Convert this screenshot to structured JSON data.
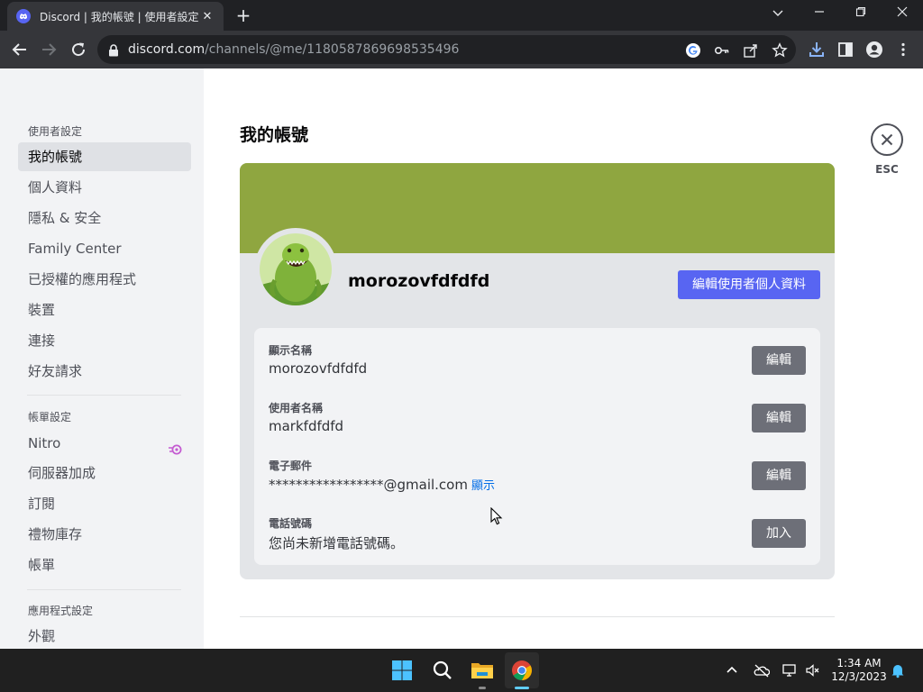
{
  "browser": {
    "tab_title": "Discord | 我的帳號 | 使用者設定",
    "url_host": "discord.com",
    "url_path": "/channels/@me/1180587869698535496"
  },
  "sidebar": {
    "user_settings_header": "使用者設定",
    "user_items": [
      {
        "label": "我的帳號",
        "active": true
      },
      {
        "label": "個人資料"
      },
      {
        "label": "隱私 & 安全"
      },
      {
        "label": "Family Center"
      },
      {
        "label": "已授權的應用程式"
      },
      {
        "label": "裝置"
      },
      {
        "label": "連接"
      },
      {
        "label": "好友請求"
      }
    ],
    "billing_settings_header": "帳單設定",
    "billing_items": [
      {
        "label": "Nitro"
      },
      {
        "label": "伺服器加成"
      },
      {
        "label": "訂閱"
      },
      {
        "label": "禮物庫存"
      },
      {
        "label": "帳單"
      }
    ],
    "app_settings_header": "應用程式設定",
    "app_items": [
      {
        "label": "外觀"
      }
    ]
  },
  "main": {
    "title": "我的帳號",
    "close_label": "ESC",
    "banner_color": "#8fa640",
    "username": "morozovfdfdfd",
    "edit_profile_label": "編輯使用者個人資料",
    "fields": [
      {
        "label": "顯示名稱",
        "value": "morozovfdfdfd",
        "button": "編輯"
      },
      {
        "label": "使用者名稱",
        "value": "markfdfdfd",
        "button": "編輯"
      },
      {
        "label": "電子郵件",
        "value": "*****************@gmail.com",
        "reveal": "顯示",
        "button": "編輯"
      },
      {
        "label": "電話號碼",
        "value": "您尚未新增電話號碼。",
        "button": "加入"
      }
    ]
  },
  "taskbar": {
    "time": "1:34 AM",
    "date": "12/3/2023"
  },
  "colors": {
    "blurple": "#5865f2",
    "nitro_pink": "#c45bd1",
    "link_blue": "#006ce7"
  }
}
